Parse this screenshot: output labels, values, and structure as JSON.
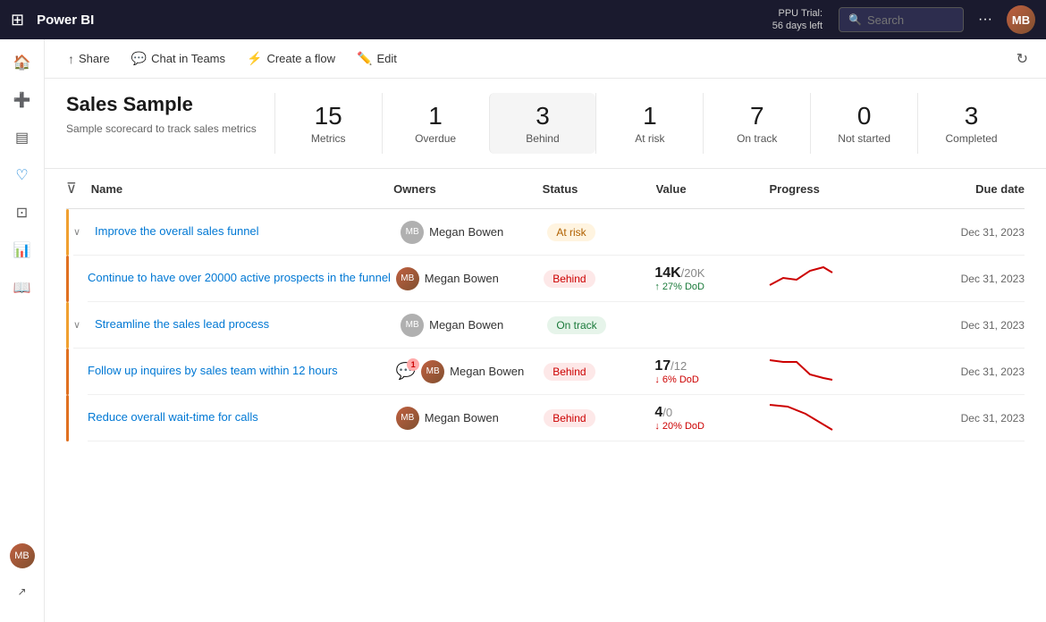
{
  "topbar": {
    "logo": "Power BI",
    "trial_line1": "PPU Trial:",
    "trial_line2": "56 days left",
    "search_placeholder": "Search",
    "more_icon": "···",
    "avatar_initials": "MB"
  },
  "toolbar": {
    "share_label": "Share",
    "chat_label": "Chat in Teams",
    "create_label": "Create a flow",
    "edit_label": "Edit"
  },
  "scorecard": {
    "title": "Sales Sample",
    "subtitle": "Sample scorecard to track sales metrics",
    "cards": [
      {
        "num": "15",
        "label": "Metrics"
      },
      {
        "num": "1",
        "label": "Overdue"
      },
      {
        "num": "3",
        "label": "Behind",
        "active": true
      },
      {
        "num": "1",
        "label": "At risk"
      },
      {
        "num": "7",
        "label": "On track"
      },
      {
        "num": "0",
        "label": "Not started"
      },
      {
        "num": "3",
        "label": "Completed"
      }
    ]
  },
  "table": {
    "columns": [
      "Name",
      "Owners",
      "Status",
      "Value",
      "Progress",
      "Due date"
    ],
    "rows": [
      {
        "id": "row1",
        "type": "parent",
        "name": "Improve the overall sales funnel",
        "owner": "Megan Bowen",
        "owner_grey": true,
        "status": "At risk",
        "status_class": "status-at-risk",
        "value": "",
        "progress": "",
        "due_date": "Dec 31, 2023",
        "indent": 0,
        "expanded": true
      },
      {
        "id": "row2",
        "type": "child",
        "name": "Continue to have over 20000 active prospects in the funnel",
        "owner": "Megan Bowen",
        "owner_grey": false,
        "status": "Behind",
        "status_class": "status-behind",
        "value_main": "14K",
        "value_sub": "/20K",
        "value_change": "↑ 27% DoD",
        "value_change_dir": "up",
        "due_date": "Dec 31, 2023",
        "indent": 1,
        "chart": "up_then_down"
      },
      {
        "id": "row3",
        "type": "parent",
        "name": "Streamline the sales lead process",
        "owner": "Megan Bowen",
        "owner_grey": true,
        "status": "On track",
        "status_class": "status-on-track",
        "value": "",
        "progress": "",
        "due_date": "Dec 31, 2023",
        "indent": 0,
        "expanded": true
      },
      {
        "id": "row4",
        "type": "child",
        "name": "Follow up inquires by sales team within 12 hours",
        "owner": "Megan Bowen",
        "owner_grey": false,
        "status": "Behind",
        "status_class": "status-behind",
        "value_main": "17",
        "value_sub": "/12",
        "value_change": "↓ 6% DoD",
        "value_change_dir": "down",
        "due_date": "Dec 31, 2023",
        "indent": 1,
        "has_notif": true,
        "chart": "down_steep"
      },
      {
        "id": "row5",
        "type": "child",
        "name": "Reduce overall wait-time for calls",
        "owner": "Megan Bowen",
        "owner_grey": false,
        "status": "Behind",
        "status_class": "status-behind",
        "value_main": "4",
        "value_sub": "/0",
        "value_change": "↓ 20% DoD",
        "value_change_dir": "down",
        "due_date": "Dec 31, 2023",
        "indent": 1,
        "chart": "down_sharp"
      }
    ]
  },
  "sidebar": {
    "items": [
      {
        "icon": "⊞",
        "name": "grid"
      },
      {
        "icon": "+",
        "name": "create"
      },
      {
        "icon": "▤",
        "name": "browse"
      },
      {
        "icon": "♥",
        "name": "favorites"
      },
      {
        "icon": "⊡",
        "name": "apps"
      },
      {
        "icon": "📊",
        "name": "metrics"
      },
      {
        "icon": "⬡",
        "name": "learn"
      }
    ]
  }
}
